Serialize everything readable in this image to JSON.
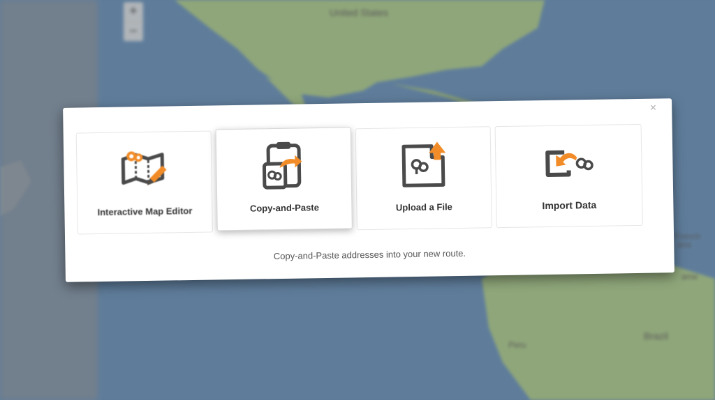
{
  "map": {
    "zoom_in": "+",
    "zoom_out": "−",
    "labels": {
      "country_us": "United States",
      "country_brazil": "Brazil",
      "country_peru": "Peru",
      "partial_french": "French",
      "partial_guiana": "ana",
      "partial_name": "ame"
    }
  },
  "modal": {
    "close": "×",
    "options": [
      {
        "label": "Interactive Map Editor",
        "icon": "map-pins-pencil-icon"
      },
      {
        "label": "Copy-and-Paste",
        "icon": "clipboard-arrow-icon"
      },
      {
        "label": "Upload a File",
        "icon": "file-upload-icon"
      },
      {
        "label": "Import Data",
        "icon": "import-data-icon"
      }
    ],
    "selected_index": 1,
    "hint": "Copy-and-Paste addresses into your new route."
  },
  "colors": {
    "accent": "#f28c28",
    "icon_dark": "#4a4a4a",
    "ocean": "#5f7d9b",
    "land": "#8fa67a"
  }
}
